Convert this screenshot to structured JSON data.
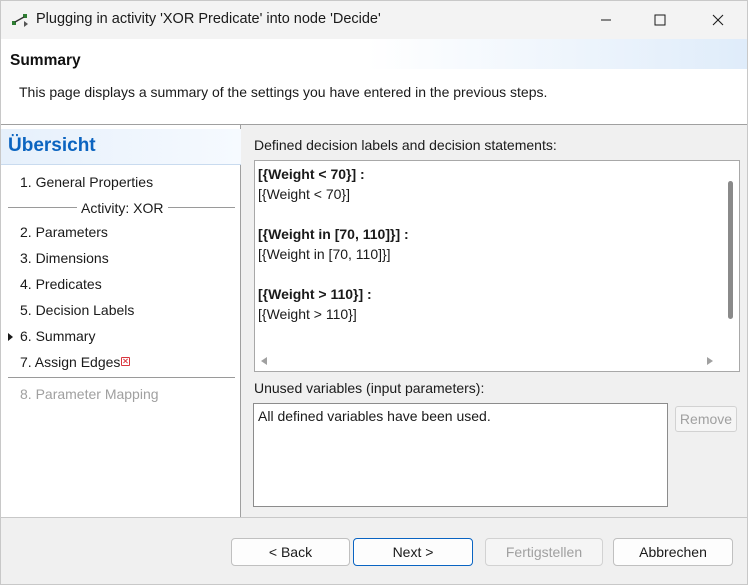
{
  "window": {
    "title": "Plugging in activity 'XOR Predicate' into node 'Decide'",
    "controls": [
      "minimize-icon",
      "maximize-icon",
      "close-icon"
    ]
  },
  "header": {
    "title": "Summary",
    "description": "This page displays a summary of the settings you have entered in the previous steps."
  },
  "nav": {
    "title": "Übersicht",
    "items": [
      {
        "label": "1. General Properties"
      },
      {
        "label": "2. Parameters"
      },
      {
        "label": "3. Dimensions"
      },
      {
        "label": "4. Predicates"
      },
      {
        "label": "5. Decision Labels"
      },
      {
        "label": "6. Summary"
      },
      {
        "label": "7. Assign Edges"
      },
      {
        "label": "8. Parameter Mapping"
      }
    ],
    "group_label": "Activity: XOR",
    "current_index": 5,
    "error_item_index": 6,
    "disabled_item_index": 7
  },
  "content": {
    "statements_label": "Defined decision labels and decision statements:",
    "statements": [
      {
        "label": "[{Weight < 70}] :",
        "statement": "[{Weight < 70}]"
      },
      {
        "label": "[{Weight in [70, 110]}] :",
        "statement": "[{Weight in [70, 110]}]"
      },
      {
        "label": "[{Weight > 110}] :",
        "statement": "[{Weight > 110}]"
      }
    ],
    "unused_label": "Unused variables (input parameters):",
    "unused_text": "All defined variables have been used.",
    "remove_label": "Remove"
  },
  "buttons": {
    "back": "< Back",
    "next": "Next >",
    "finish": "Fertigstellen",
    "cancel": "Abbrechen"
  },
  "colors": {
    "accent": "#0b64c0",
    "error": "#d9363e",
    "disabled_text": "#a0a0a0"
  }
}
